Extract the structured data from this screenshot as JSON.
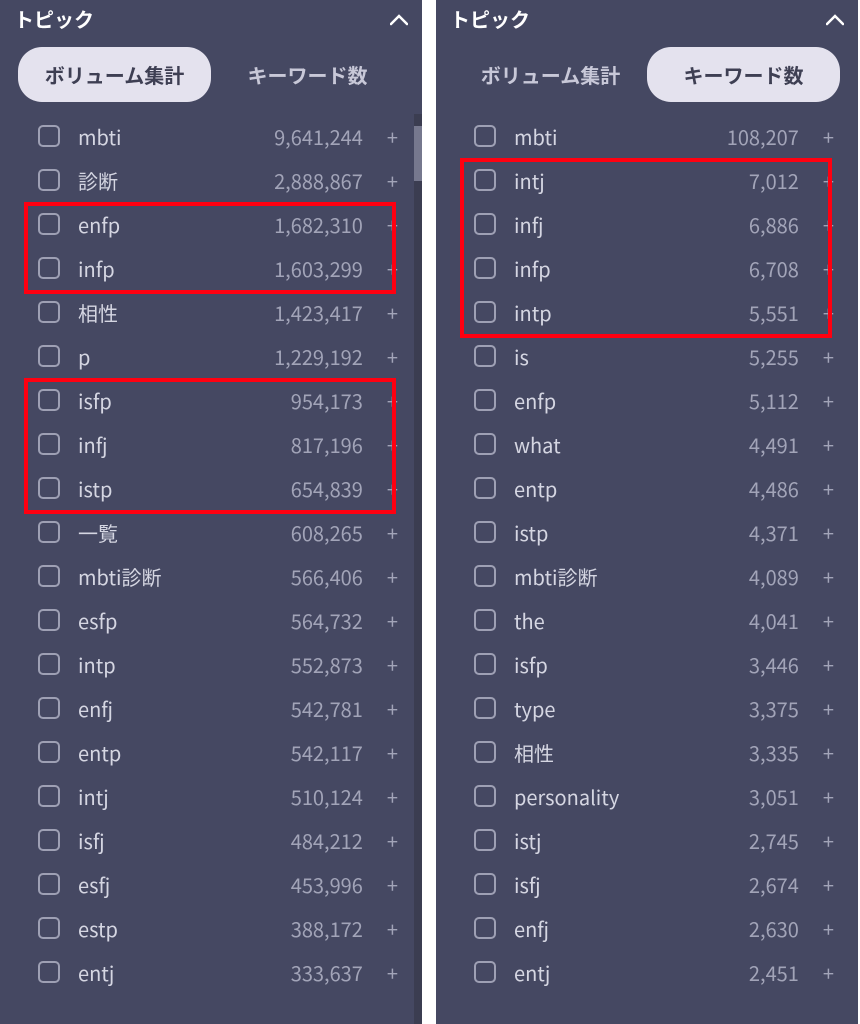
{
  "left_panel": {
    "title": "トピック",
    "tabs": {
      "volume": "ボリューム集計",
      "keywords": "キーワード数",
      "active": "volume"
    },
    "items": [
      {
        "label": "mbti",
        "value": "9,641,244"
      },
      {
        "label": "診断",
        "value": "2,888,867"
      },
      {
        "label": "enfp",
        "value": "1,682,310"
      },
      {
        "label": "infp",
        "value": "1,603,299"
      },
      {
        "label": "相性",
        "value": "1,423,417"
      },
      {
        "label": "p",
        "value": "1,229,192"
      },
      {
        "label": "isfp",
        "value": "954,173"
      },
      {
        "label": "infj",
        "value": "817,196"
      },
      {
        "label": "istp",
        "value": "654,839"
      },
      {
        "label": "一覧",
        "value": "608,265"
      },
      {
        "label": "mbti診断",
        "value": "566,406"
      },
      {
        "label": "esfp",
        "value": "564,732"
      },
      {
        "label": "intp",
        "value": "552,873"
      },
      {
        "label": "enfj",
        "value": "542,781"
      },
      {
        "label": "entp",
        "value": "542,117"
      },
      {
        "label": "intj",
        "value": "510,124"
      },
      {
        "label": "isfj",
        "value": "484,212"
      },
      {
        "label": "esfj",
        "value": "453,996"
      },
      {
        "label": "estp",
        "value": "388,172"
      },
      {
        "label": "entj",
        "value": "333,637"
      }
    ],
    "highlights": [
      {
        "start": 2,
        "end": 3
      },
      {
        "start": 6,
        "end": 8
      }
    ]
  },
  "right_panel": {
    "title": "トピック",
    "tabs": {
      "volume": "ボリューム集計",
      "keywords": "キーワード数",
      "active": "keywords"
    },
    "items": [
      {
        "label": "mbti",
        "value": "108,207"
      },
      {
        "label": "intj",
        "value": "7,012"
      },
      {
        "label": "infj",
        "value": "6,886"
      },
      {
        "label": "infp",
        "value": "6,708"
      },
      {
        "label": "intp",
        "value": "5,551"
      },
      {
        "label": "is",
        "value": "5,255"
      },
      {
        "label": "enfp",
        "value": "5,112"
      },
      {
        "label": "what",
        "value": "4,491"
      },
      {
        "label": "entp",
        "value": "4,486"
      },
      {
        "label": "istp",
        "value": "4,371"
      },
      {
        "label": "mbti診断",
        "value": "4,089"
      },
      {
        "label": "the",
        "value": "4,041"
      },
      {
        "label": "isfp",
        "value": "3,446"
      },
      {
        "label": "type",
        "value": "3,375"
      },
      {
        "label": "相性",
        "value": "3,335"
      },
      {
        "label": "personality",
        "value": "3,051"
      },
      {
        "label": "istj",
        "value": "2,745"
      },
      {
        "label": "isfj",
        "value": "2,674"
      },
      {
        "label": "enfj",
        "value": "2,630"
      },
      {
        "label": "entj",
        "value": "2,451"
      }
    ],
    "highlights": [
      {
        "start": 1,
        "end": 4
      }
    ]
  }
}
